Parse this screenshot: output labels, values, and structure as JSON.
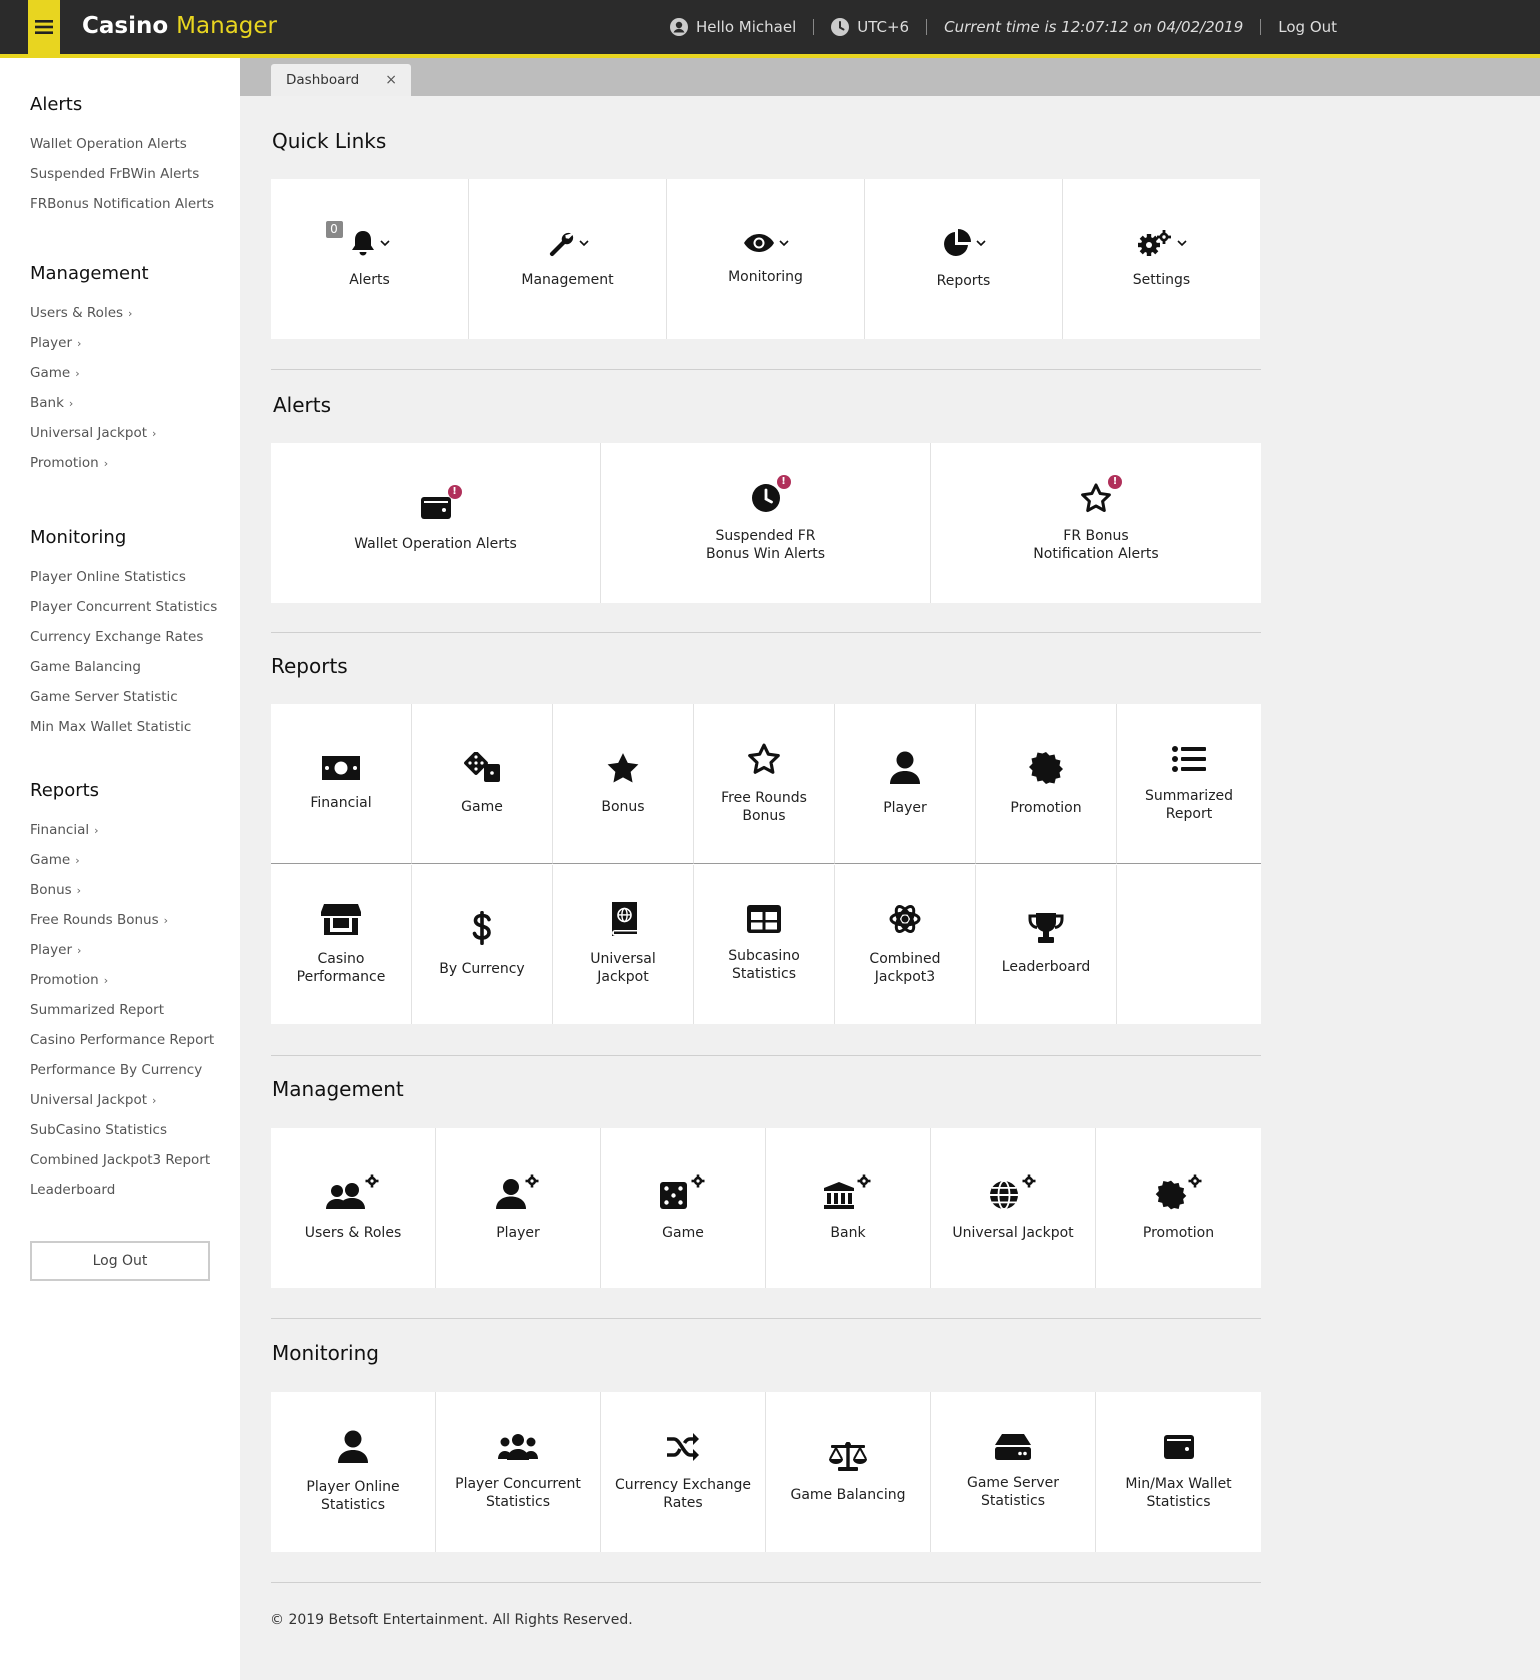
{
  "header": {
    "brand_main": "Casino",
    "brand_accent": "Manager",
    "greeting": "Hello Michael",
    "timezone": "UTC+6",
    "current_time": "Current time is 12:07:12 on 04/02/2019",
    "logout": "Log Out",
    "colors": {
      "bar": "#2b2b2b",
      "accent": "#e8d520"
    }
  },
  "sidebar": {
    "alerts": {
      "title": "Alerts",
      "items": [
        "Wallet Operation Alerts",
        "Suspended FrBWin Alerts",
        "FRBonus Notification Alerts"
      ]
    },
    "management": {
      "title": "Management",
      "items": [
        "Users & Roles",
        "Player",
        "Game",
        "Bank",
        "Universal Jackpot",
        "Promotion"
      ]
    },
    "monitoring": {
      "title": "Monitoring",
      "items": [
        "Player Online Statistics",
        "Player Concurrent Statistics",
        "Currency Exchange Rates",
        "Game Balancing",
        "Game Server Statistic",
        "Min Max Wallet Statistic"
      ]
    },
    "reports": {
      "title": "Reports",
      "items": [
        "Financial",
        "Game",
        "Bonus",
        "Free Rounds Bonus",
        "Player",
        "Promotion",
        "Summarized Report",
        "Casino Performance Report",
        "Performance By Currency",
        "Universal Jackpot",
        "SubCasino Statistics",
        "Combined Jackpot3 Report",
        "Leaderboard"
      ]
    },
    "logout": "Log Out"
  },
  "tab": {
    "label": "Dashboard",
    "close": "×"
  },
  "quick_links": {
    "title": "Quick Links",
    "alert_count": "0",
    "items": [
      "Alerts",
      "Management",
      "Monitoring",
      "Reports",
      "Settings"
    ]
  },
  "alerts": {
    "title": "Alerts",
    "badge": "!",
    "items": [
      "Wallet Operation Alerts",
      "Suspended FR\nBonus Win Alerts",
      "FR Bonus\nNotification Alerts"
    ]
  },
  "reports": {
    "title": "Reports",
    "row1": [
      "Financial",
      "Game",
      "Bonus",
      "Free Rounds\nBonus",
      "Player",
      "Promotion",
      "Summarized\nReport"
    ],
    "row2": [
      "Casino\nPerformance",
      "By Currency",
      "Universal\nJackpot",
      "Subcasino\nStatistics",
      "Combined\nJackpot3",
      "Leaderboard"
    ]
  },
  "management": {
    "title": "Management",
    "items": [
      "Users & Roles",
      "Player",
      "Game",
      "Bank",
      "Universal Jackpot",
      "Promotion"
    ]
  },
  "monitoring": {
    "title": "Monitoring",
    "items": [
      "Player Online\nStatistics",
      "Player Concurrent\nStatistics",
      "Currency Exchange\nRates",
      "Game Balancing",
      "Game Server\nStatistics",
      "Min/Max Wallet\nStatistics"
    ]
  },
  "footer": "© 2019 Betsoft Entertainment. All Rights Reserved."
}
